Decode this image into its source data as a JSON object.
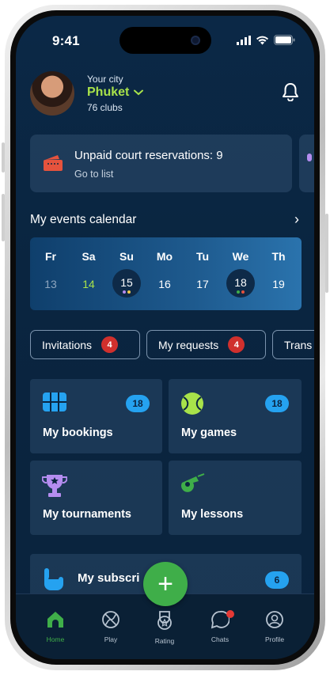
{
  "status": {
    "time": "9:41"
  },
  "header": {
    "city_label": "Your city",
    "city_name": "Phuket",
    "clubs": "76 clubs"
  },
  "banner": {
    "title": "Unpaid court reservations: 9",
    "link": "Go to list"
  },
  "calendar": {
    "title": "My events calendar",
    "days": [
      {
        "name": "Fr",
        "date": "13",
        "style": "dim"
      },
      {
        "name": "Sa",
        "date": "14",
        "style": "green"
      },
      {
        "name": "Su",
        "date": "15",
        "style": "event"
      },
      {
        "name": "Mo",
        "date": "16",
        "style": "normal"
      },
      {
        "name": "Tu",
        "date": "17",
        "style": "normal"
      },
      {
        "name": "We",
        "date": "18",
        "style": "event"
      },
      {
        "name": "Th",
        "date": "19",
        "style": "normal"
      }
    ],
    "event_dot_colors": [
      "#b58df0",
      "#f2c94c",
      "#3fae49",
      "#e5533d"
    ]
  },
  "tabs": [
    {
      "label": "Invitations",
      "badge": "4"
    },
    {
      "label": "My requests",
      "badge": "4"
    },
    {
      "label": "Trans"
    }
  ],
  "tiles": [
    {
      "label": "My bookings",
      "badge": "18",
      "icon": "court-icon"
    },
    {
      "label": "My games",
      "badge": "18",
      "icon": "tennis-ball-icon"
    },
    {
      "label": "My tournaments",
      "icon": "trophy-icon"
    },
    {
      "label": "My lessons",
      "icon": "whistle-icon"
    }
  ],
  "subscription": {
    "label": "My subscri",
    "badge": "6"
  },
  "fab": {
    "label": "+"
  },
  "tabbar": [
    {
      "label": "Home",
      "active": true
    },
    {
      "label": "Play"
    },
    {
      "label": "Rating"
    },
    {
      "label": "Chats"
    },
    {
      "label": "Profile"
    }
  ],
  "colors": {
    "accent_green": "#a8e24a",
    "badge_red": "#d0302d",
    "pill_blue": "#25a2f0",
    "fab_green": "#3fae49"
  }
}
